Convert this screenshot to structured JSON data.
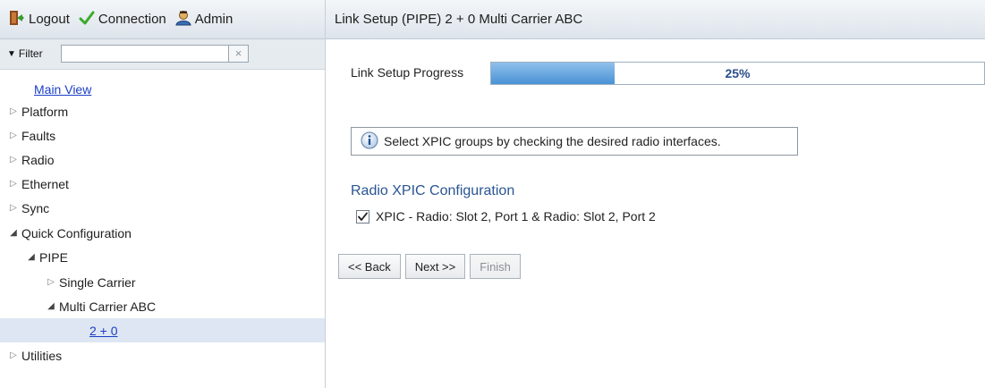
{
  "topbar": {
    "logout_label": "Logout",
    "connection_label": "Connection",
    "admin_label": "Admin"
  },
  "filter": {
    "label": "Filter",
    "value": "",
    "clear_icon": "×"
  },
  "tree": {
    "main_view": "Main View",
    "items": [
      {
        "label": "Platform",
        "state": "collapsed"
      },
      {
        "label": "Faults",
        "state": "collapsed"
      },
      {
        "label": "Radio",
        "state": "collapsed"
      },
      {
        "label": "Ethernet",
        "state": "collapsed"
      },
      {
        "label": "Sync",
        "state": "collapsed"
      },
      {
        "label": "Quick Configuration",
        "state": "expanded"
      },
      {
        "label": "PIPE",
        "state": "expanded"
      },
      {
        "label": "Single Carrier",
        "state": "collapsed"
      },
      {
        "label": "Multi Carrier ABC",
        "state": "expanded"
      },
      {
        "label": "2 + 0",
        "state": "selected"
      },
      {
        "label": "Utilities",
        "state": "collapsed"
      }
    ]
  },
  "page": {
    "title": "Link Setup (PIPE) 2 + 0 Multi Carrier ABC"
  },
  "progress": {
    "label": "Link Setup Progress",
    "value_text": "25%",
    "fraction": 0.25
  },
  "info": {
    "message": "Select XPIC groups by checking the desired radio interfaces."
  },
  "xpic": {
    "section_title": "Radio XPIC Configuration",
    "option_label": "XPIC - Radio: Slot 2, Port 1 & Radio: Slot 2, Port 2",
    "checked": true
  },
  "buttons": {
    "back_label": "<< Back",
    "next_label": "Next >>",
    "finish_label": "Finish"
  },
  "colors": {
    "accent": "#2a5592",
    "progress_fill": "#4a92d6",
    "link": "#1a3ec6"
  }
}
